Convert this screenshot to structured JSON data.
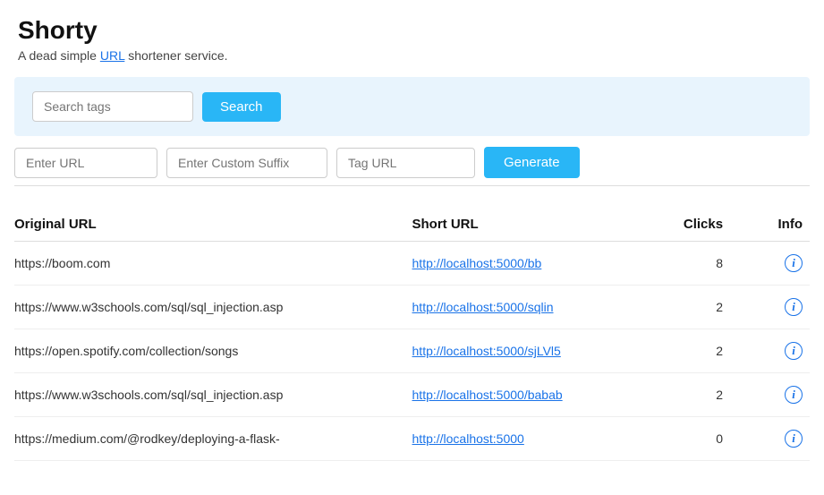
{
  "header": {
    "title": "Shorty",
    "subtitle": "A dead simple URL shortener service.",
    "subtitle_url_word": "URL"
  },
  "search_section": {
    "search_tags_placeholder": "Search tags",
    "search_button_label": "Search"
  },
  "form_section": {
    "enter_url_placeholder": "Enter URL",
    "custom_suffix_placeholder": "Enter Custom Suffix",
    "tag_url_placeholder": "Tag URL",
    "generate_button_label": "Generate"
  },
  "table": {
    "headers": {
      "original_url": "Original URL",
      "short_url": "Short URL",
      "clicks": "Clicks",
      "info": "Info"
    },
    "rows": [
      {
        "original_url": "https://boom.com",
        "short_url": "http://localhost:5000/bb",
        "clicks": "8"
      },
      {
        "original_url": "https://www.w3schools.com/sql/sql_injection.asp",
        "short_url": "http://localhost:5000/sqlin",
        "clicks": "2"
      },
      {
        "original_url": "https://open.spotify.com/collection/songs",
        "short_url": "http://localhost:5000/sjLVl5",
        "clicks": "2"
      },
      {
        "original_url": "https://www.w3schools.com/sql/sql_injection.asp",
        "short_url": "http://localhost:5000/babab",
        "clicks": "2"
      },
      {
        "original_url": "https://medium.com/@rodkey/deploying-a-flask-",
        "short_url": "http://localhost:5000",
        "clicks": "0"
      }
    ]
  }
}
